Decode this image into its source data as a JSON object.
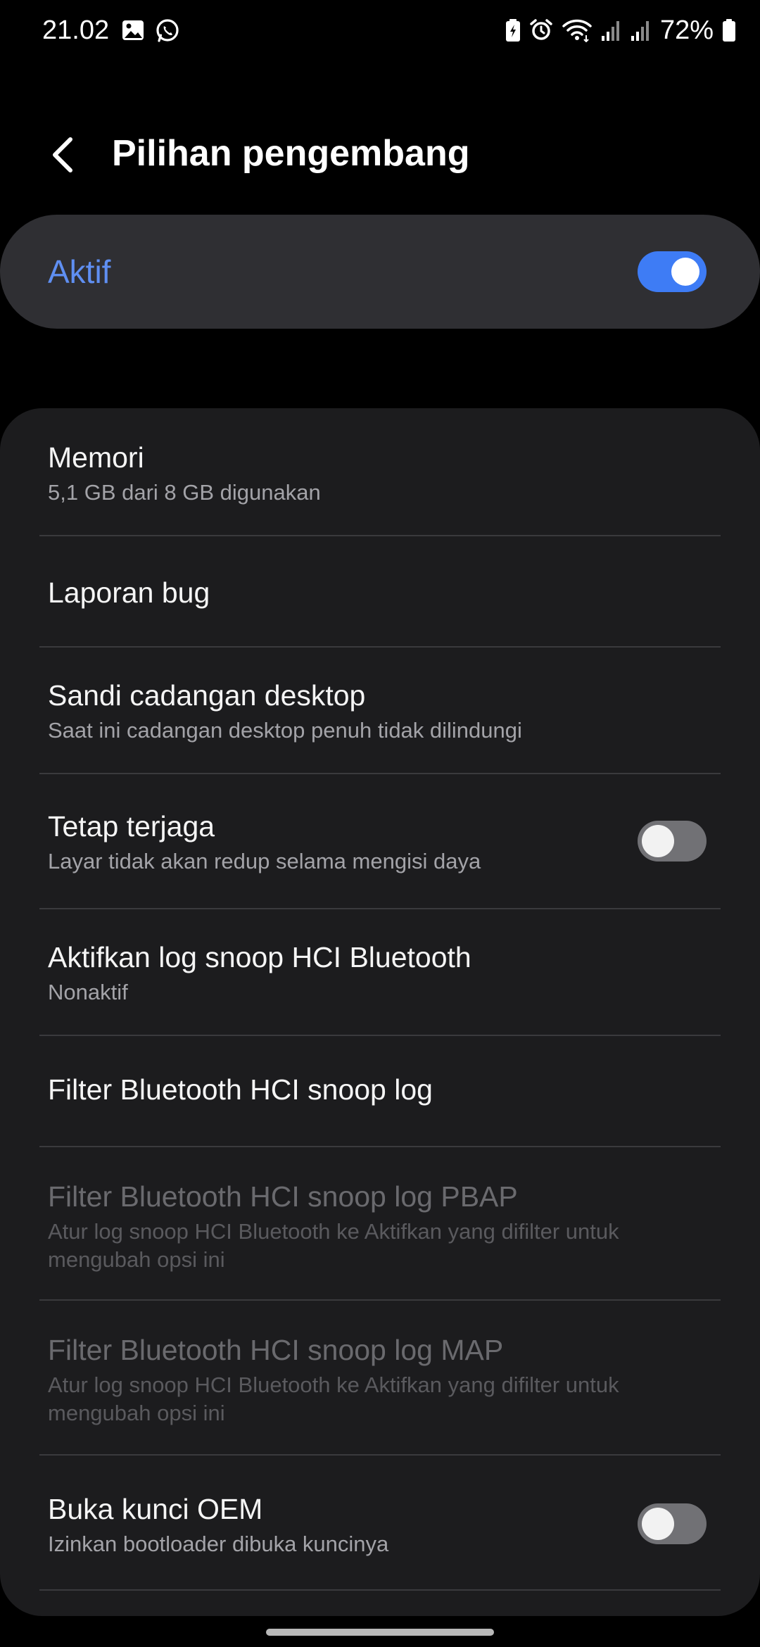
{
  "status_bar": {
    "time": "21.02",
    "left_icons": [
      "gallery-icon",
      "whatsapp-icon"
    ],
    "right_icons": [
      "battery-saver-icon",
      "alarm-icon",
      "wifi-icon",
      "signal-icon",
      "signal-icon"
    ],
    "battery_percent": "72%"
  },
  "header": {
    "back_icon": "back-arrow-icon",
    "title": "Pilihan pengembang"
  },
  "master_switch": {
    "label": "Aktif",
    "enabled": true,
    "accent_color": "#3e7cf5",
    "label_color": "#5f8ff2"
  },
  "settings": [
    {
      "title": "Memori",
      "subtitle": "5,1 GB dari 8 GB digunakan"
    },
    {
      "title": "Laporan bug"
    },
    {
      "title": "Sandi cadangan desktop",
      "subtitle": "Saat ini cadangan desktop penuh tidak dilindungi"
    },
    {
      "title": "Tetap terjaga",
      "subtitle": "Layar tidak akan redup selama mengisi daya",
      "toggle": false
    },
    {
      "title": "Aktifkan log snoop HCI Bluetooth",
      "subtitle": "Nonaktif"
    },
    {
      "title": "Filter Bluetooth HCI snoop log"
    },
    {
      "title": "Filter Bluetooth HCI snoop log PBAP",
      "subtitle": "Atur log snoop HCI Bluetooth ke Aktifkan yang difilter untuk mengubah opsi ini",
      "disabled": true
    },
    {
      "title": "Filter Bluetooth HCI snoop log MAP",
      "subtitle": "Atur log snoop HCI Bluetooth ke Aktifkan yang difilter untuk mengubah opsi ini",
      "disabled": true
    },
    {
      "title": "Buka kunci OEM",
      "subtitle": "Izinkan bootloader dibuka kuncinya",
      "toggle": false
    }
  ]
}
